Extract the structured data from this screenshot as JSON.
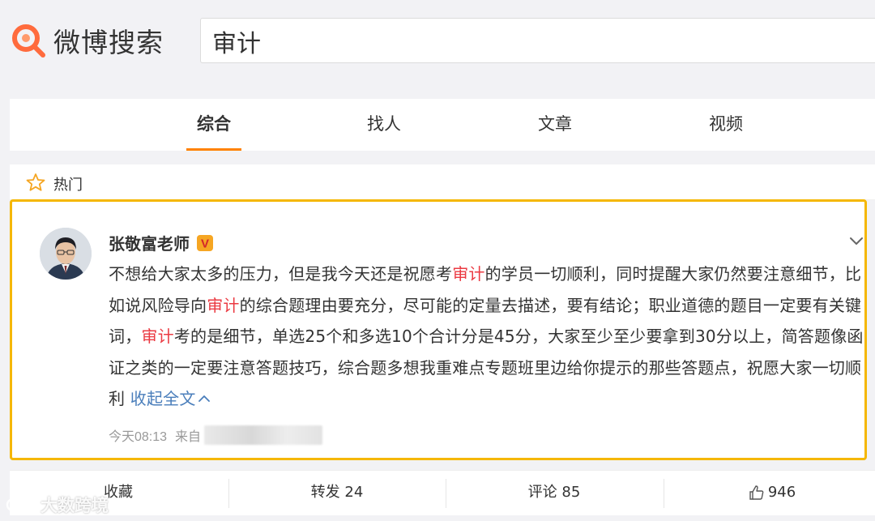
{
  "header": {
    "logo_text": "微博搜索",
    "search_value": "审计"
  },
  "tabs": [
    {
      "label": "综合",
      "active": true
    },
    {
      "label": "找人",
      "active": false
    },
    {
      "label": "文章",
      "active": false
    },
    {
      "label": "视频",
      "active": false
    }
  ],
  "section": {
    "label": "热门",
    "icon": "star-outline-icon"
  },
  "post": {
    "author": "张敬富老师",
    "badge": "V",
    "text_segments": [
      "不想给大家太多的压力，但是我今天还是祝愿考",
      "审计",
      "的学员一切顺利，同时提醒大家仍然要注意细节，比如说风险导向",
      "审计",
      "的综合题理由要充分，尽可能的定量去描述，要有结论；职业道德的题目一定要有关键词，",
      "审计",
      "考的是细节，单选25个和多选10个合计分是45分，大家至少至少要拿到30分以上，简答题像函证之类的一定要注意答题技巧，综合题多想我重难点专题班里边给你提示的那些答题点，祝愿大家一切顺利"
    ],
    "collapse_label": "收起全文",
    "time": "今天08:13",
    "from_label": "来自"
  },
  "actions": {
    "favorite": "收藏",
    "repost": "转发 24",
    "comment": "评论 85",
    "like_count": "946"
  },
  "watermark": {
    "text": "大数跨境"
  },
  "colors": {
    "accent": "#ff8200",
    "highlight": "#eb3b43",
    "link": "#4a7ebb",
    "card_border": "#f5b700"
  }
}
